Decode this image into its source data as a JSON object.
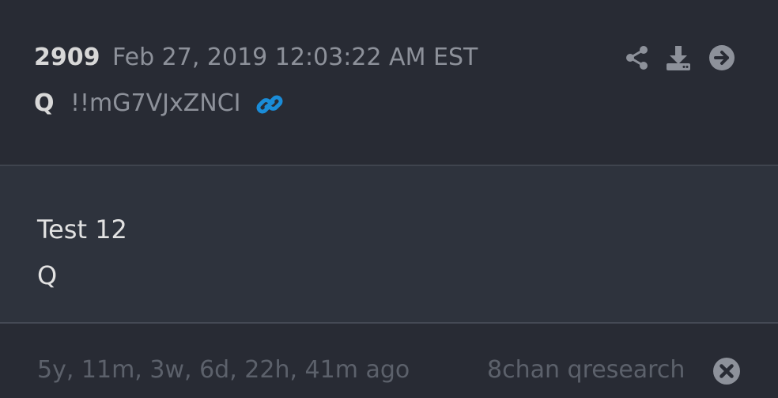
{
  "post": {
    "number": "2909",
    "date": "Feb 27, 2019 12:03:22 AM EST",
    "author": "Q",
    "tripcode": "!!mG7VJxZNCI",
    "body_lines": [
      "Test 12",
      "Q"
    ]
  },
  "footer": {
    "ago": "5y, 11m, 3w, 6d, 22h, 41m ago",
    "source": "8chan qresearch"
  },
  "icons": {
    "share": "share-icon",
    "download": "download-icon",
    "go": "arrow-circle-right-icon",
    "link": "link-icon",
    "close": "close-circle-icon"
  },
  "colors": {
    "background": "#282b34",
    "body_background": "#2e333d",
    "link_accent": "#1a8cd8",
    "muted_text": "#8d919a",
    "primary_text": "#d8d8d8"
  }
}
